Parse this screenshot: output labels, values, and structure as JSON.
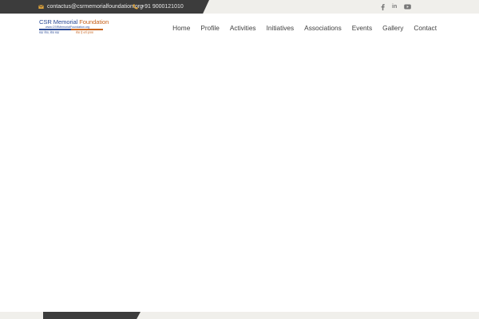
{
  "topbar": {
    "email": "contactus@csrmemorialfoundation.org",
    "phone": "+91 9000121010",
    "social": [
      {
        "icon": "facebook-icon"
      },
      {
        "icon": "linkedin-icon",
        "label": "in"
      },
      {
        "icon": "youtube-icon"
      }
    ]
  },
  "logo": {
    "name_part1": "CSR Memorial",
    "name_part2": "Foundation",
    "website": "www.CSRMemorialFoundation.org",
    "tagline_left": "सदा सेवा, सेवा सदा",
    "tagline_right": "सेवा है धर्म हमारा"
  },
  "nav": {
    "items": [
      "Home",
      "Profile",
      "Activities",
      "Initiatives",
      "Associations",
      "Events",
      "Gallery",
      "Contact"
    ]
  },
  "colors": {
    "dark": "#3c3c3c",
    "light": "#f0efeb",
    "accent": "#e0a43a",
    "logo_blue": "#2a4a96",
    "logo_orange": "#c8641e"
  }
}
